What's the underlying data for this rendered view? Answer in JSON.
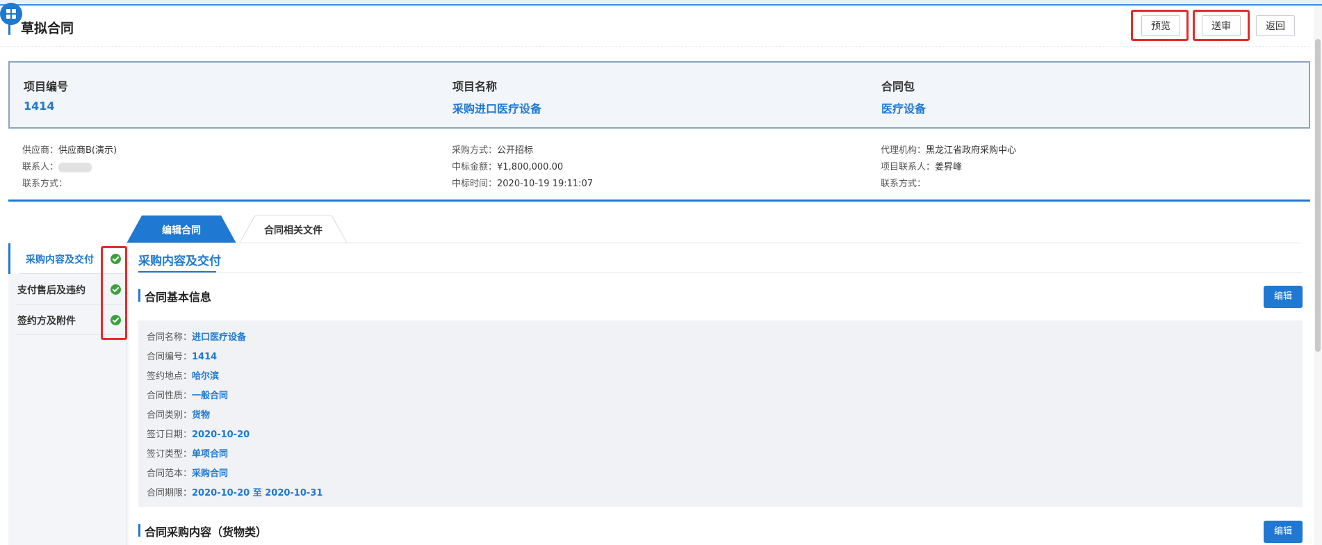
{
  "page": {
    "title": "草拟合同"
  },
  "header_buttons": {
    "preview": "预览",
    "submit": "送审",
    "back": "返回"
  },
  "project": {
    "number_label": "项目编号",
    "number_value": "1414",
    "name_label": "项目名称",
    "name_value": "采购进口医疗设备",
    "package_label": "合同包",
    "package_value": "医疗设备"
  },
  "meta": {
    "supplier_label": "供应商：",
    "supplier_value": "供应商B(演示)",
    "contact_label": "联系人：",
    "contact_method_label": "联系方式：",
    "method_label": "采购方式：",
    "method_value": "公开招标",
    "amount_label": "中标金额：",
    "amount_value": "¥1,800,000.00",
    "time_label": "中标时间：",
    "time_value": "2020-10-19 19:11:07",
    "agency_label": "代理机构：",
    "agency_value": "黑龙江省政府采购中心",
    "project_contact_label": "项目联系人：",
    "project_contact_value": "姜昇峰",
    "agency_contact_method_label": "联系方式："
  },
  "tabs": [
    {
      "label": "编辑合同",
      "active": true
    },
    {
      "label": "合同相关文件",
      "active": false
    }
  ],
  "sidebar": {
    "items": [
      {
        "label": "采购内容及交付",
        "done": true,
        "active": true
      },
      {
        "label": "支付售后及违约",
        "done": true,
        "active": false
      },
      {
        "label": "签约方及附件",
        "done": true,
        "active": false
      }
    ]
  },
  "section": {
    "tab_label": "采购内容及交付",
    "basic_info_title": "合同基本信息",
    "purchase_content_title": "合同采购内容（货物类）",
    "edit_label": "编辑"
  },
  "contract_info": [
    {
      "label": "合同名称：",
      "value": "进口医疗设备"
    },
    {
      "label": "合同编号：",
      "value": "1414"
    },
    {
      "label": "签约地点：",
      "value": "哈尔滨"
    },
    {
      "label": "合同性质：",
      "value": "一般合同"
    },
    {
      "label": "合同类别：",
      "value": "货物"
    },
    {
      "label": "签订日期：",
      "value": "2020-10-20"
    },
    {
      "label": "签订类型：",
      "value": "单项合同"
    },
    {
      "label": "合同范本：",
      "value": "采购合同"
    },
    {
      "label": "合同期限：",
      "value": "2020-10-20 至 2020-10-31"
    }
  ],
  "colors": {
    "accent": "#1f78d1",
    "highlight_box": "#e52b2b",
    "check": "#3aa13a"
  }
}
